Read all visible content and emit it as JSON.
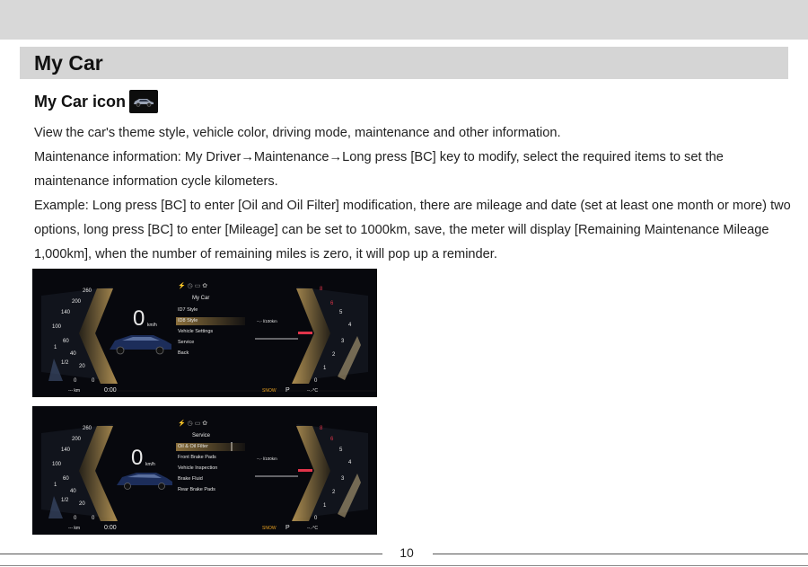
{
  "page": {
    "title": "My Car",
    "subtitle": "My Car icon",
    "page_number": "10"
  },
  "paragraphs": [
    "View the car's theme style, vehicle color, driving mode, maintenance and other information.",
    "Maintenance information: My Driver→Maintenance→Long press [BC] key to modify, select the required items to set the maintenance information cycle kilometers.",
    "Example: Long press [BC] to enter [Oil and Oil Filter] modification, there are mileage and date (set at least one month or more) two options, long press [BC] to enter [Mileage] can be set to 1000km, save, the meter will display [Remaining Maintenance Mileage 1,000km], when the number of remaining miles is zero, it will pop up a reminder."
  ],
  "dashboards": [
    {
      "speed": "0",
      "speed_unit": "km/h",
      "menu_title": "My Car",
      "menu_items": [
        "ID7 Style",
        "ID8 Style",
        "Vehicle Settings",
        "Service",
        "Back"
      ],
      "selected_index": 1,
      "left_scale": [
        "260",
        "200",
        "140",
        "100",
        "60",
        "40",
        "20",
        "0"
      ],
      "right_scale": [
        "8",
        "6",
        "5",
        "4",
        "3",
        "2",
        "1",
        "0"
      ],
      "fuel_marks": [
        "1",
        "1/2",
        "0"
      ],
      "consumption": "--.- l/100km",
      "odo": "--- km",
      "time": "0:00",
      "drive_mode": "SNOW",
      "gear": "P",
      "temp": "--.-°C"
    },
    {
      "speed": "0",
      "speed_unit": "km/h",
      "menu_title": "Service",
      "menu_items": [
        "Oil & Oil Filter",
        "Front Brake Pads",
        "Vehicle Inspection",
        "Brake Fluid",
        "Rear Brake Pads"
      ],
      "selected_index": 0,
      "left_scale": [
        "260",
        "200",
        "140",
        "100",
        "60",
        "40",
        "20",
        "0"
      ],
      "right_scale": [
        "8",
        "6",
        "5",
        "4",
        "3",
        "2",
        "1",
        "0"
      ],
      "fuel_marks": [
        "1",
        "1/2",
        "0"
      ],
      "consumption": "--.- l/100km",
      "odo": "--- km",
      "time": "0:00",
      "drive_mode": "SNOW",
      "gear": "P",
      "temp": "--.-°C"
    }
  ],
  "colors": {
    "title_band": "#d5d5d5",
    "dash_bg": "#07080d",
    "gold": "#c9a45c",
    "redline": "#e0344a",
    "mode_orange": "#e8a020"
  },
  "icons": [
    "car-icon"
  ]
}
